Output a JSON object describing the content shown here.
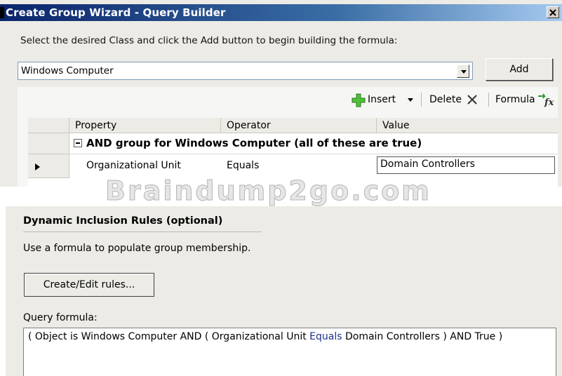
{
  "window": {
    "title": "Create Group Wizard - Query Builder",
    "close_icon": "close-icon"
  },
  "query_builder": {
    "instruction": "Select the desired Class and click the Add button to begin building the formula:",
    "class_value": "Windows Computer",
    "add_label": "Add",
    "toolbar": {
      "insert_label": "Insert",
      "delete_label": "Delete",
      "formula_label": "Formula"
    },
    "columns": [
      "Property",
      "Operator",
      "Value"
    ],
    "group_label": "AND group for Windows Computer (all of these are true)",
    "condition": {
      "property": "Organizational Unit",
      "operator": "Equals",
      "value": "Domain Controllers"
    }
  },
  "watermark": "Braindump2go.com",
  "dynamic_rules": {
    "title": "Dynamic Inclusion Rules (optional)",
    "description": "Use a formula to populate group membership.",
    "edit_button": "Create/Edit rules...",
    "formula_label": "Query formula:",
    "formula": {
      "part1": "( Object is Windows Computer AND ( Organizational Unit ",
      "keyword": "Equals",
      "part2": " Domain Controllers ) AND True )"
    }
  },
  "colors": {
    "titlebar": "#0a246a",
    "panel": "#ecebe6",
    "keyword": "#1e2f8a"
  }
}
